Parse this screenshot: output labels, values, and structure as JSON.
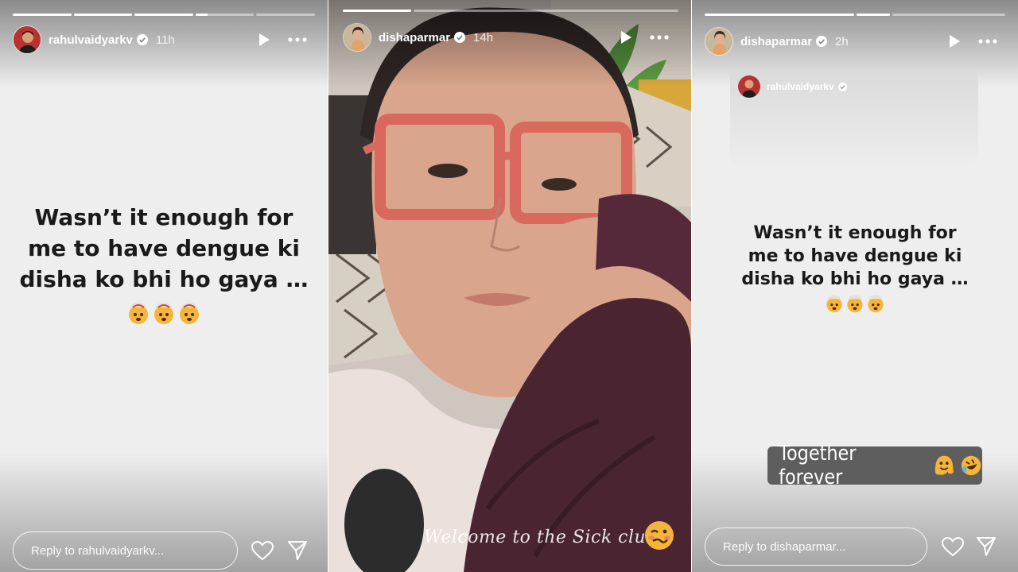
{
  "stories": [
    {
      "username": "rahulvaidyarkv",
      "timestamp": "11h",
      "progress": [
        1,
        1,
        1,
        0.2,
        0
      ],
      "text_lines": [
        "Wasn’t it enough for",
        "me to have dengue ki",
        "disha ko bhi ho gaya …"
      ],
      "emoji_count": 3,
      "reply_placeholder": "Reply to rahulvaidyarkv..."
    },
    {
      "username": "dishaparmar",
      "timestamp": "14h",
      "progress": [
        1,
        0
      ],
      "caption": "Welcome to the Sick club!"
    },
    {
      "username": "dishaparmar",
      "timestamp": "2h",
      "progress": [
        1,
        0.2,
        0
      ],
      "quoted_username": "rahulvaidyarkv",
      "text_lines": [
        "Wasn’t it enough for",
        "me to have dengue ki",
        "disha ko bhi ho gaya …"
      ],
      "emoji_count": 3,
      "sticker_text": "Together forever",
      "reply_placeholder": "Reply to dishaparmar..."
    }
  ],
  "icons": {
    "verified": "verified-badge-icon",
    "play": "play-icon",
    "more": "more-options-icon",
    "heart": "heart-icon",
    "send": "send-icon",
    "exploding_head": "exploding-head-emoji",
    "woozy": "woozy-face-emoji",
    "melting": "melting-face-emoji",
    "rofl": "rolling-laughing-emoji"
  },
  "colors": {
    "story_background": "#eeeeee",
    "verified_blue": "#3897f0",
    "sticker_background": "#5e5e5e",
    "blanket": "#4a2430",
    "glasses": "#d9695e"
  }
}
